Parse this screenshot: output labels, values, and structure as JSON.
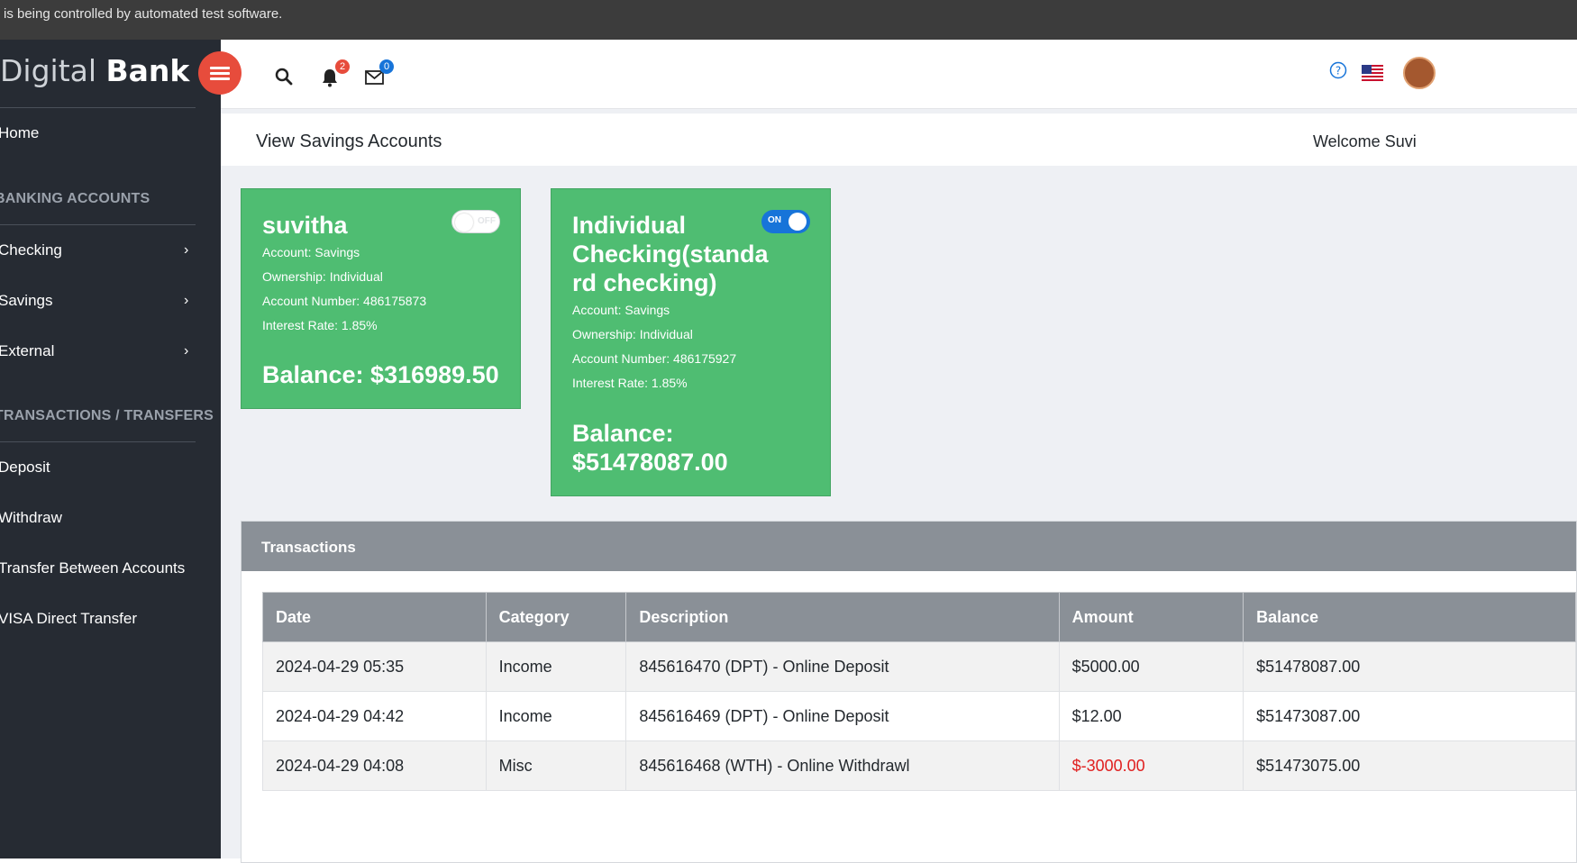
{
  "banner": {
    "text": "is being controlled by automated test software."
  },
  "brand": {
    "part1": "Digital ",
    "part2": "Bank"
  },
  "sidebar": {
    "home": "Home",
    "section_accounts": "BANKING ACCOUNTS",
    "items_accounts": [
      {
        "label": "Checking",
        "chevron": "›"
      },
      {
        "label": "Savings",
        "chevron": "›"
      },
      {
        "label": "External",
        "chevron": "›"
      }
    ],
    "section_transactions": "TRANSACTIONS / TRANSFERS",
    "items_transactions": [
      {
        "label": "Deposit"
      },
      {
        "label": "Withdraw"
      },
      {
        "label": "Transfer Between Accounts"
      },
      {
        "label": "VISA Direct Transfer"
      }
    ]
  },
  "topbar": {
    "notifications_count": "2",
    "messages_count": "0",
    "icons": [
      "search-icon",
      "bell-icon",
      "envelope-icon",
      "help-icon",
      "us-flag-icon",
      "avatar"
    ],
    "colors": {
      "notif_badge": "#e74c3c",
      "msg_badge": "#1774d9"
    }
  },
  "page": {
    "title": "View Savings Accounts",
    "welcome": "Welcome Suvi"
  },
  "cards": [
    {
      "name": "suvitha",
      "toggle": "OFF",
      "account": "Account: Savings",
      "ownership": "Ownership: Individual",
      "number": "Account Number: 486175873",
      "rate": "Interest Rate: 1.85%",
      "balance": "Balance: $316989.50"
    },
    {
      "name_lines": [
        "Individual",
        "Checking(standa",
        "rd checking)"
      ],
      "toggle": "ON",
      "account": "Account: Savings",
      "ownership": "Ownership: Individual",
      "number": "Account Number: 486175927",
      "rate": "Interest Rate: 1.85%",
      "balance_lines": [
        "Balance:",
        "$51478087.00"
      ]
    }
  ],
  "transactions": {
    "title": "Transactions",
    "columns": [
      "Date",
      "Category",
      "Description",
      "Amount",
      "Balance"
    ],
    "rows": [
      {
        "date": "2024-04-29 05:35",
        "category": "Income",
        "description": "845616470 (DPT) - Online Deposit",
        "amount": "$5000.00",
        "balance": "$51478087.00"
      },
      {
        "date": "2024-04-29 04:42",
        "category": "Income",
        "description": "845616469 (DPT) - Online Deposit",
        "amount": "$12.00",
        "balance": "$51473087.00"
      },
      {
        "date": "2024-04-29 04:08",
        "category": "Misc",
        "description": "845616468 (WTH) - Online Withdrawl",
        "amount": "$-3000.00",
        "balance": "$51473075.00"
      }
    ]
  }
}
